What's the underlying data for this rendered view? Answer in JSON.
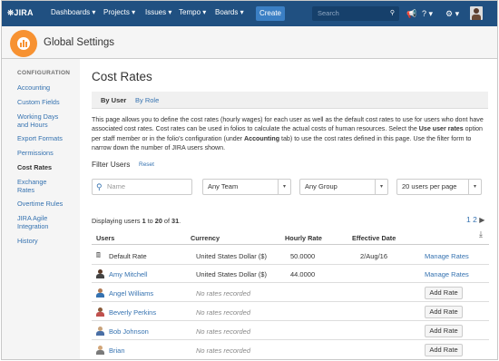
{
  "topnav": {
    "logo": "JIRA",
    "menu": [
      "Dashboards ▾",
      "Projects ▾",
      "Issues ▾",
      "Tempo ▾",
      "Boards ▾"
    ],
    "create": "Create",
    "search_placeholder": "Search",
    "icons": [
      "search-icon",
      "feedback-icon",
      "help-icon",
      "settings-icon",
      "user-avatar"
    ]
  },
  "header": {
    "title": "Global Settings"
  },
  "sidebar": {
    "heading": "CONFIGURATION",
    "items": [
      "Accounting",
      "Custom Fields",
      "Working Days and Hours",
      "Export Formats",
      "Permissions",
      "Cost Rates",
      "Exchange Rates",
      "Overtime Rules",
      "JIRA Agile Integration",
      "History"
    ],
    "active": "Cost Rates"
  },
  "main": {
    "title": "Cost Rates",
    "tabs": [
      "By User",
      "By Role"
    ],
    "desc_1": "This page allows you to define the cost rates (hourly wages) for each user as well as the default cost rates to use for users who dont have associated cost rates. Cost rates can be used in folios to calculate the actual costs of human resources. Select the ",
    "desc_b1": "Use user rates",
    "desc_2": " option per staff member or in the folio's configuration (under ",
    "desc_b2": "Accounting",
    "desc_3": " tab) to use the cost rates defined in this page. Use the filter form to narrow down the number of JIRA users shown."
  },
  "filter": {
    "label": "Filter Users",
    "reset": "Reset",
    "name_placeholder": "Name",
    "team": "Any Team",
    "group": "Any Group",
    "per_page": "20 users per page"
  },
  "paging": {
    "pre": "Displaying users ",
    "from": "1",
    "mid1": " to ",
    "to": "20",
    "mid2": " of ",
    "total": "31",
    "end": ".",
    "page1": "1",
    "page2": "2"
  },
  "table": {
    "headers": [
      "Users",
      "Currency",
      "Hourly Rate",
      "Effective Date"
    ],
    "rows": [
      {
        "name": "Default Rate",
        "currency": "United States Dollar ($)",
        "rate": "50.0000",
        "date": "2/Aug/16",
        "action": "Manage Rates"
      },
      {
        "name": "Amy Mitchell",
        "currency": "United States Dollar ($)",
        "rate": "44.0000",
        "date": "",
        "action": "Manage Rates"
      },
      {
        "name": "Angel Williams",
        "currency": "No rates recorded",
        "rate": "",
        "date": "",
        "action": "Add Rate"
      },
      {
        "name": "Beverly Perkins",
        "currency": "No rates recorded",
        "rate": "",
        "date": "",
        "action": "Add Rate"
      },
      {
        "name": "Bob Johnson",
        "currency": "No rates recorded",
        "rate": "",
        "date": "",
        "action": "Add Rate"
      },
      {
        "name": "Brian",
        "currency": "No rates recorded",
        "rate": "",
        "date": "",
        "action": "Add Rate"
      }
    ]
  },
  "colors": {
    "nav": "#205081",
    "accent": "#f79232",
    "link": "#3572b0"
  }
}
